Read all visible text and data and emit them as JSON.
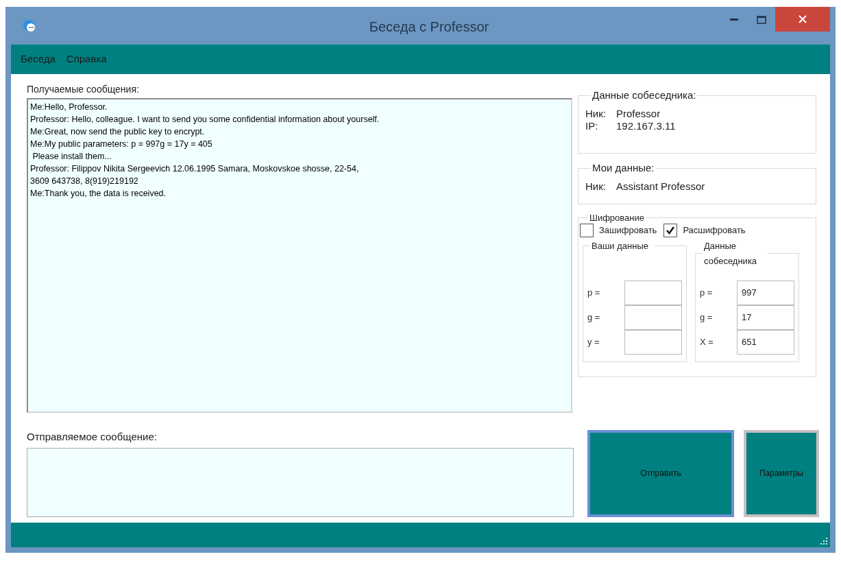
{
  "window": {
    "title": "Беседа с Professor"
  },
  "menu": [
    "Беседа",
    "Справка"
  ],
  "received": {
    "label": "Получаемые сообщения:",
    "lines": [
      "Me:Hello, Professor.",
      "Professor: Hello, colleague. I want to send you some confidential information about yourself.",
      "Me:Great, now send the public key to encrypt.",
      "Me:My public parameters: p = 997g = 17y = 405",
      " Please install them...",
      "Professor: Filippov Nikita Sergeevich 12.06.1995 Samara, Moskovskoe shosse, 22-54,",
      "3609 643738, 8(919)219192",
      "Me:Thank you, the data is received."
    ]
  },
  "peer": {
    "title": "Данные собеседника:",
    "rows": [
      {
        "label": "Ник:",
        "value": "Professor"
      },
      {
        "label": "IP:",
        "value": "192.167.3.11"
      }
    ]
  },
  "mine": {
    "title": "Мои данные:",
    "rows": [
      {
        "label": "Ник:",
        "value": "Assistant Professor"
      }
    ]
  },
  "encryption": {
    "title": "Шифрование",
    "modes": [
      {
        "label": "Зашифровать",
        "checked": false
      },
      {
        "label": "Расшифровать",
        "checked": true
      }
    ],
    "groups": [
      {
        "title": "Ваши данные",
        "fields": [
          {
            "label": "p ="
          },
          {
            "label": "g ="
          },
          {
            "label": "y ="
          }
        ]
      },
      {
        "title": "Данные собеседника",
        "fields": [
          {
            "label": "p =",
            "value": "997"
          },
          {
            "label": "g =",
            "value": "17"
          },
          {
            "label": "X =",
            "value": "651"
          }
        ]
      }
    ]
  },
  "outgoing": {
    "label": "Отправляемое сообщение:"
  },
  "buttons": [
    {
      "label": "Отправить",
      "focused": true
    },
    {
      "label": "Параметры",
      "focused": false
    }
  ]
}
